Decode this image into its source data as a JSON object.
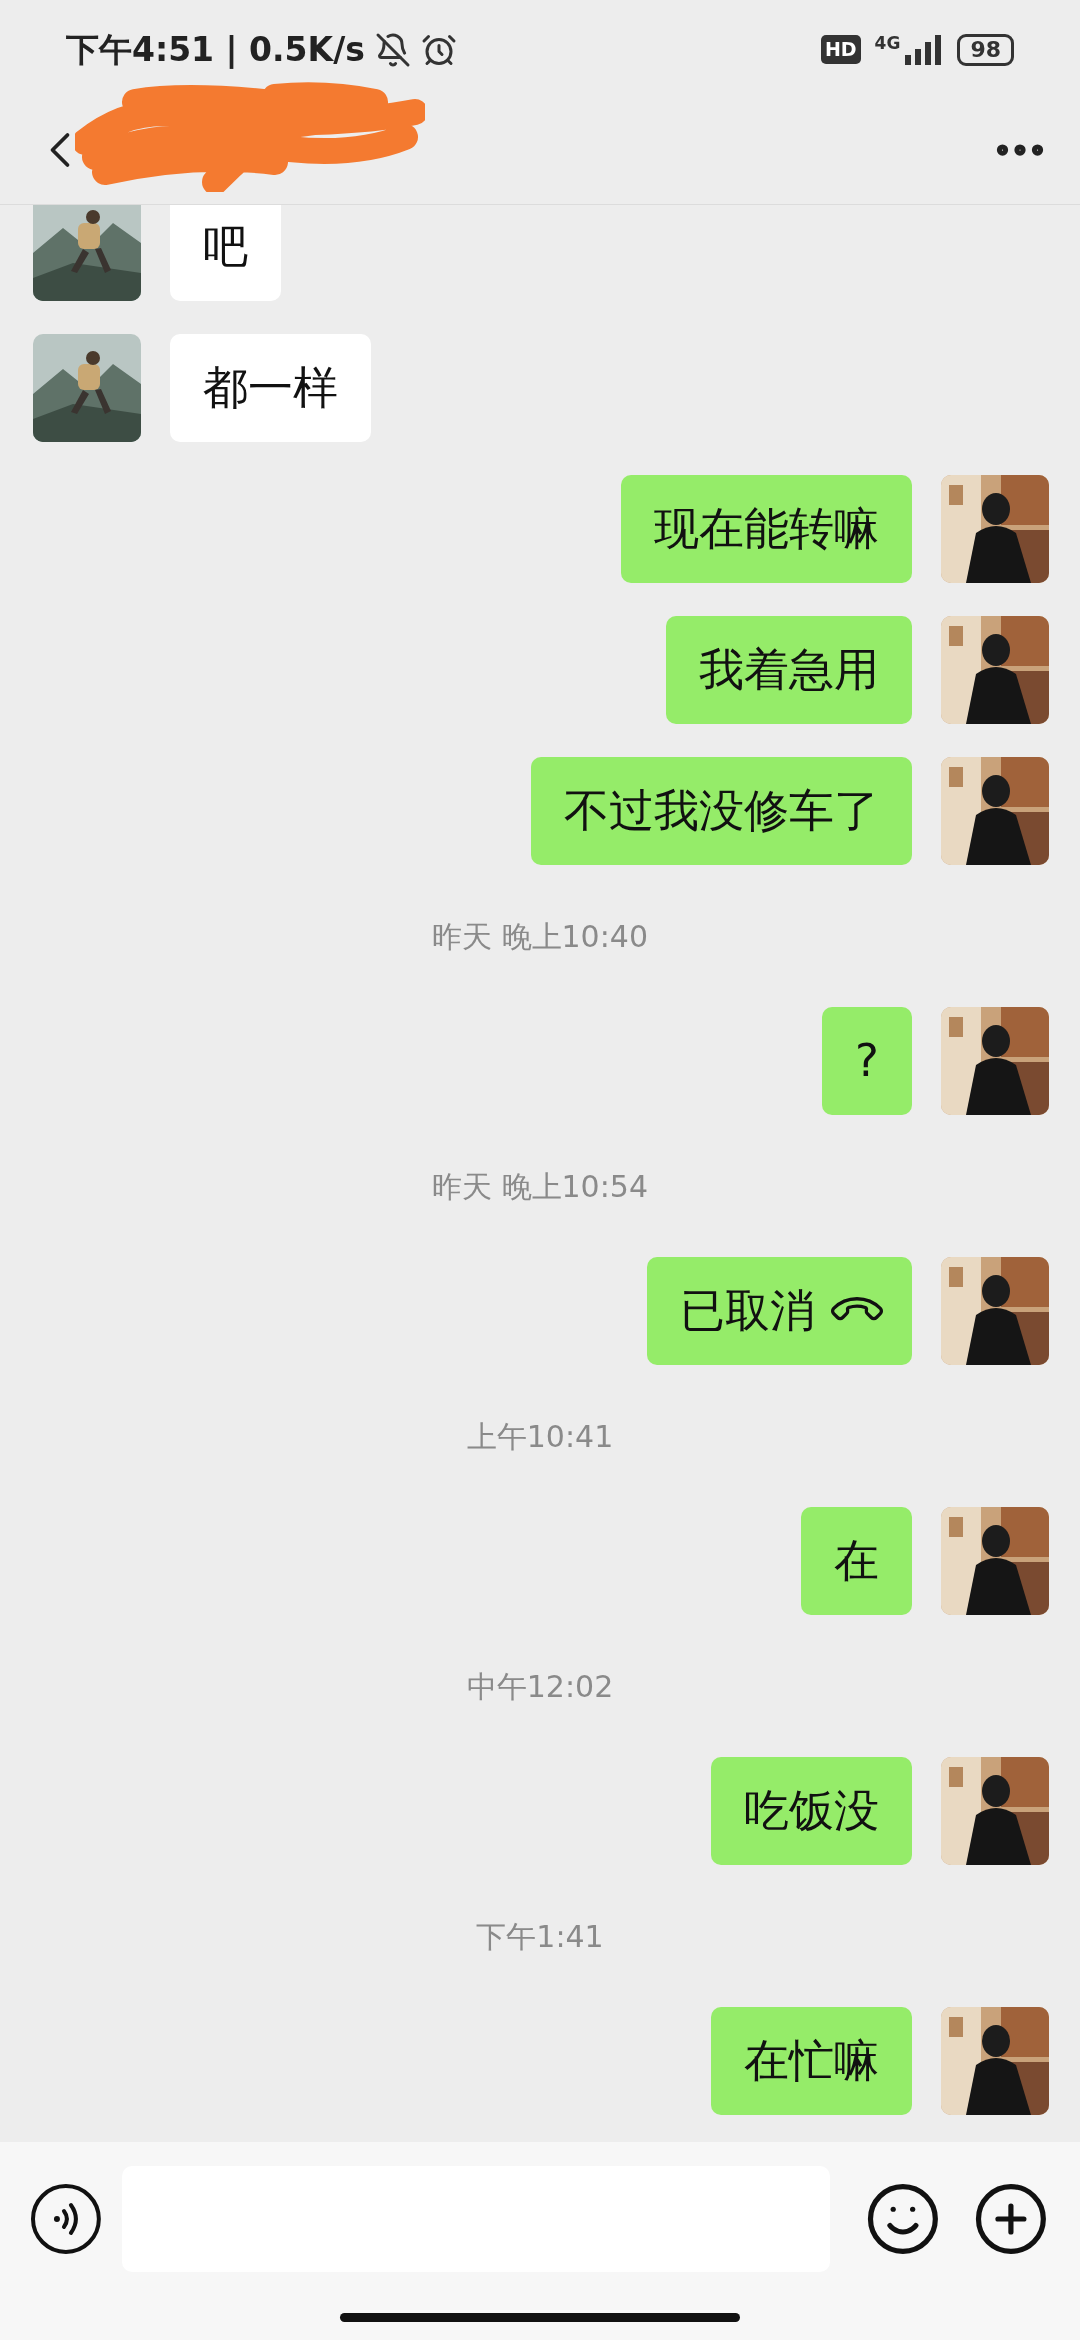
{
  "status_bar": {
    "time_and_speed": "下午4:51 | 0.5K/s",
    "hd": "HD",
    "network": "4G",
    "battery": "98"
  },
  "messages": [
    {
      "kind": "message",
      "outgoing": false,
      "text": "吧"
    },
    {
      "kind": "message",
      "outgoing": false,
      "text": "都一样"
    },
    {
      "kind": "message",
      "outgoing": true,
      "text": "现在能转嘛"
    },
    {
      "kind": "message",
      "outgoing": true,
      "text": "我着急用"
    },
    {
      "kind": "message",
      "outgoing": true,
      "text": "不过我没修车了"
    },
    {
      "kind": "time",
      "text": "昨天 晚上10:40"
    },
    {
      "kind": "message",
      "outgoing": true,
      "text": "?"
    },
    {
      "kind": "time",
      "text": "昨天 晚上10:54"
    },
    {
      "kind": "call",
      "outgoing": true,
      "text": "已取消"
    },
    {
      "kind": "time",
      "text": "上午10:41"
    },
    {
      "kind": "message",
      "outgoing": true,
      "text": "在"
    },
    {
      "kind": "time",
      "text": "中午12:02"
    },
    {
      "kind": "message",
      "outgoing": true,
      "text": "吃饭没"
    },
    {
      "kind": "time",
      "text": "下午1:41"
    },
    {
      "kind": "message",
      "outgoing": true,
      "text": "在忙嘛"
    }
  ]
}
